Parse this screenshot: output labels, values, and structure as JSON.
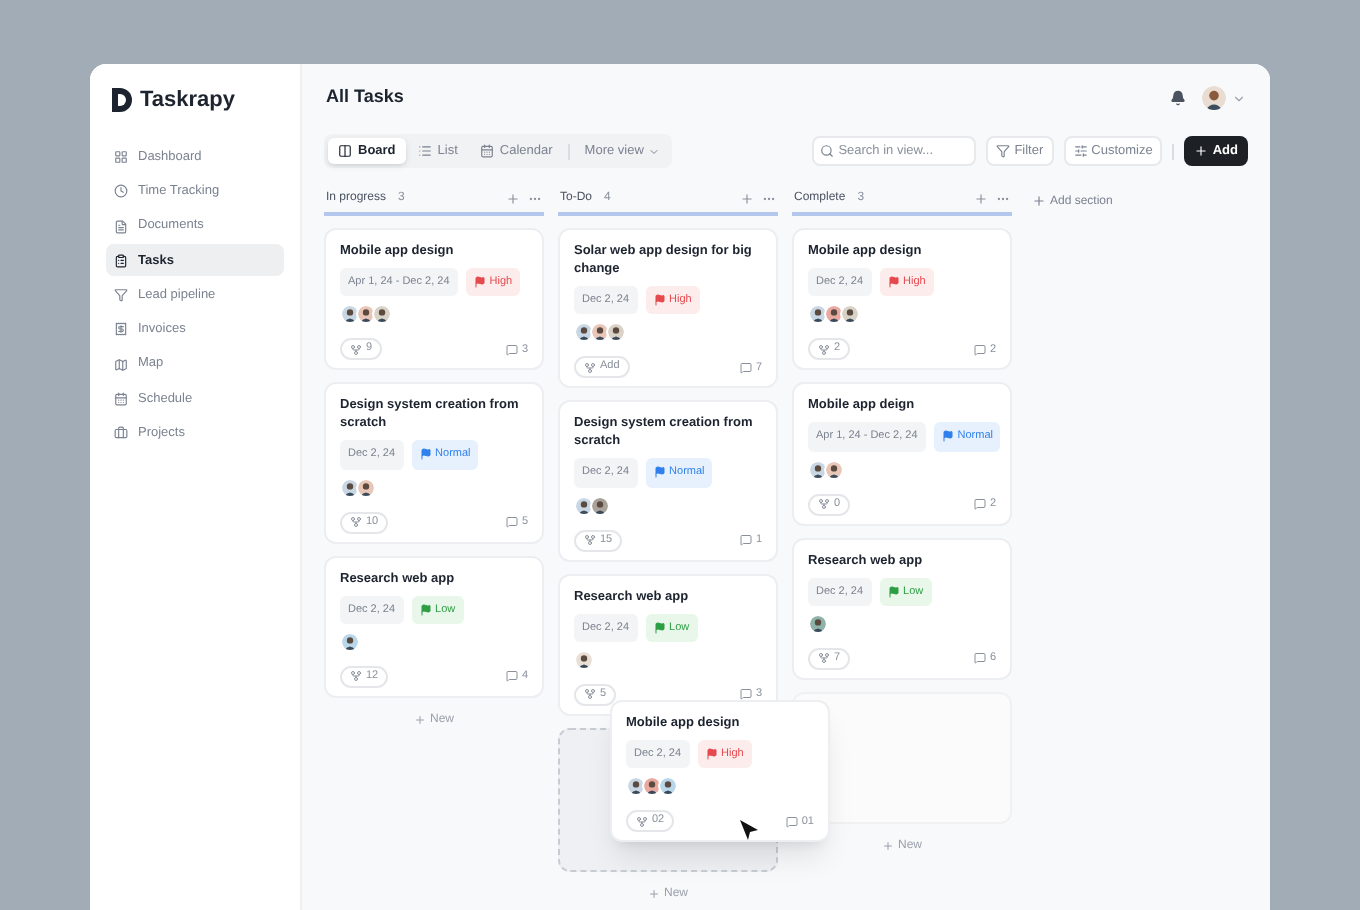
{
  "brand": {
    "name": "Taskrapy"
  },
  "sidebar": {
    "items": [
      {
        "label": "Dashboard",
        "selected": false
      },
      {
        "label": "Time Tracking",
        "selected": false
      },
      {
        "label": "Documents",
        "selected": false
      },
      {
        "label": "Tasks",
        "selected": true
      },
      {
        "label": "Lead pipeline",
        "selected": false
      },
      {
        "label": "Invoices",
        "selected": false
      },
      {
        "label": "Map",
        "selected": false
      },
      {
        "label": "Schedule",
        "selected": false
      },
      {
        "label": "Projects",
        "selected": false
      }
    ]
  },
  "header": {
    "title": "All Tasks"
  },
  "views": [
    {
      "label": "Board",
      "selected": true
    },
    {
      "label": "List",
      "selected": false
    },
    {
      "label": "Calendar",
      "selected": false
    }
  ],
  "more_view": "More view",
  "search": {
    "placeholder": "Search in view..."
  },
  "actions": {
    "filter": "Filter",
    "customize": "Customize",
    "add": "Add"
  },
  "add_section": "Add section",
  "columns": [
    {
      "title": "In progress",
      "count": "3",
      "new_label": "New",
      "cards": [
        {
          "title": "Mobile app design",
          "date": "Apr 1, 24 - Dec 2, 24",
          "priority": {
            "label": "High",
            "kind": "high"
          },
          "assignees": [
            {
              "color": "#c9d6e3"
            },
            {
              "color": "#e9c7b8"
            },
            {
              "color": "#d9d2c6"
            }
          ],
          "subtasks": "9",
          "comments": "3"
        },
        {
          "title": "Design system creation from scratch",
          "date": "Dec 2, 24",
          "priority": {
            "label": "Normal",
            "kind": "normal"
          },
          "assignees": [
            {
              "color": "#c9d6e3"
            },
            {
              "color": "#e9c7b8"
            }
          ],
          "subtasks": "10",
          "comments": "5"
        },
        {
          "title": "Research web app",
          "date": "Dec 2, 24",
          "priority": {
            "label": "Low",
            "kind": "low"
          },
          "assignees": [
            {
              "color": "#b9d7ea"
            }
          ],
          "subtasks": "12",
          "comments": "4"
        }
      ]
    },
    {
      "title": "To-Do",
      "count": "4",
      "new_label": "New",
      "drop_placeholder": true,
      "cards": [
        {
          "title": "Solar web app design for big change",
          "date": "Dec 2, 24",
          "priority": {
            "label": "High",
            "kind": "high"
          },
          "assignees": [
            {
              "color": "#c9d6e3"
            },
            {
              "color": "#e9c7b8"
            },
            {
              "color": "#d9d2c6"
            }
          ],
          "subtasks": "Add",
          "comments": "7"
        },
        {
          "title": "Design system creation from scratch",
          "date": "Dec 2, 24",
          "priority": {
            "label": "Normal",
            "kind": "normal"
          },
          "assignees": [
            {
              "color": "#c9d6e3"
            },
            {
              "color": "#a9a39a"
            }
          ],
          "subtasks": "15",
          "comments": "1"
        },
        {
          "title": "Research web app",
          "date": "Dec 2, 24",
          "priority": {
            "label": "Low",
            "kind": "low"
          },
          "assignees": [
            {
              "color": "#eadfd5"
            }
          ],
          "subtasks": "5",
          "comments": "3"
        }
      ]
    },
    {
      "title": "Complete",
      "count": "3",
      "new_label": "New",
      "empty_slot": true,
      "cards": [
        {
          "title": "Mobile app design",
          "date": "Dec 2, 24",
          "priority": {
            "label": "High",
            "kind": "high"
          },
          "assignees": [
            {
              "color": "#c9d6e3"
            },
            {
              "color": "#e9a9a0"
            },
            {
              "color": "#d9d2c6"
            }
          ],
          "subtasks": "2",
          "comments": "2"
        },
        {
          "title": "Mobile app deign",
          "date": "Apr 1, 24 - Dec 2, 24",
          "priority": {
            "label": "Normal",
            "kind": "normal"
          },
          "assignees": [
            {
              "color": "#c9d6e3"
            },
            {
              "color": "#e9c7b8"
            }
          ],
          "subtasks": "0",
          "comments": "2"
        },
        {
          "title": "Research web app",
          "date": "Dec 2, 24",
          "priority": {
            "label": "Low",
            "kind": "low"
          },
          "assignees": [
            {
              "color": "#8fb3a8"
            }
          ],
          "subtasks": "7",
          "comments": "6"
        }
      ]
    }
  ],
  "dragged_card": {
    "title": "Mobile app design",
    "date": "Dec 2, 24",
    "priority": {
      "label": "High",
      "kind": "high"
    },
    "assignees": [
      {
        "color": "#c9d6e3"
      },
      {
        "color": "#e9a9a0"
      },
      {
        "color": "#b9d7ea"
      }
    ],
    "subtasks": "02",
    "comments": "01"
  }
}
